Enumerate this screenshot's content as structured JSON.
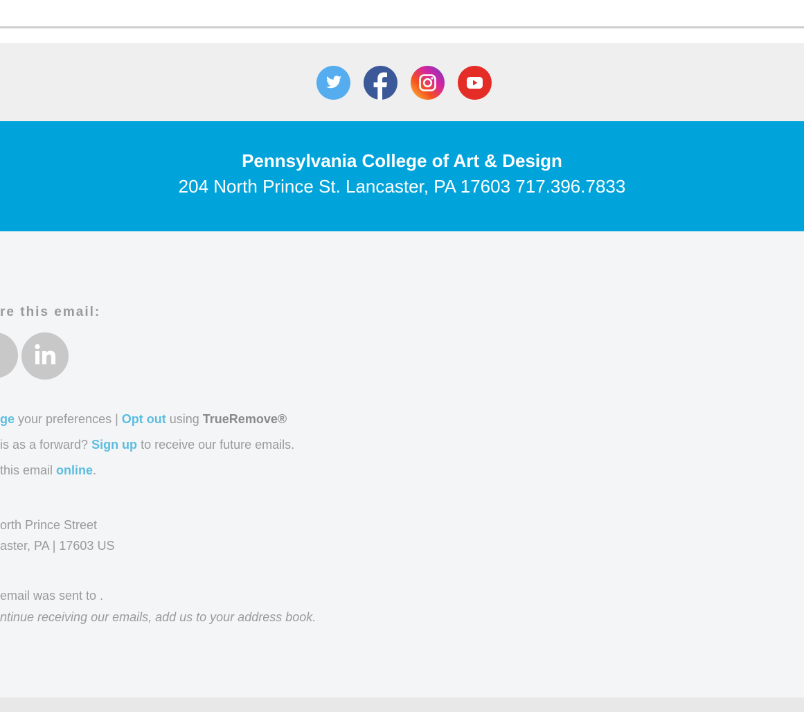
{
  "colors": {
    "brand_blue": "#00a3da",
    "link_blue": "#5bbde0",
    "social_band_bg": "#efefef",
    "footer_bg": "#f4f5f7",
    "muted_text": "#9a9a9a",
    "twitter": "#55acee",
    "facebook": "#3b5998",
    "youtube": "#e52d27"
  },
  "social": {
    "icons": [
      "twitter-icon",
      "facebook-icon",
      "instagram-icon",
      "youtube-icon"
    ]
  },
  "org": {
    "name": "Pennsylvania College of Art & Design",
    "address_line": "204 North Prince St. Lancaster, PA  17603   717.396.7833"
  },
  "share": {
    "label": "re this email:",
    "icons": [
      "share-partial-icon",
      "linkedin-icon"
    ]
  },
  "prefs": {
    "manage_link": "ge",
    "manage_suffix": " your preferences | ",
    "opt_out_link": "Opt out",
    "using_text": " using ",
    "trueremove": "TrueRemove®"
  },
  "forward": {
    "prefix": "is as a forward? ",
    "signup_link": "Sign up",
    "suffix": " to receive our future emails."
  },
  "online": {
    "prefix": "this email ",
    "link": "online",
    "suffix": "."
  },
  "postal": {
    "line1": "orth Prince Street",
    "line2": "aster, PA | 17603 US"
  },
  "sent": {
    "line1": "email was sent to .",
    "line2": "ntinue receiving our emails, add us to your address book."
  }
}
